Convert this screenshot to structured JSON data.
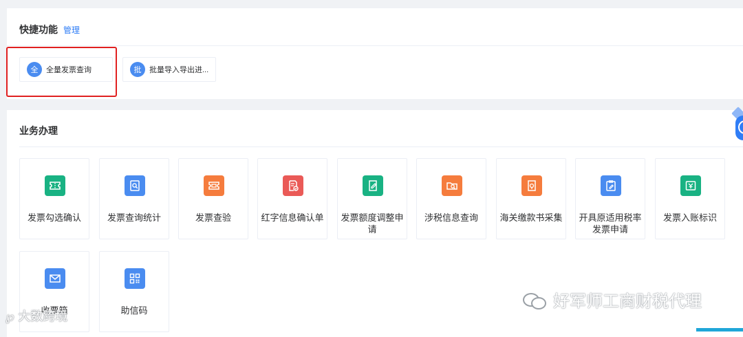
{
  "quick": {
    "title": "快捷功能",
    "manage_link": "管理",
    "items": [
      {
        "badge": "全",
        "label": "全量发票查询"
      },
      {
        "badge": "批",
        "label": "批量导入导出进..."
      }
    ]
  },
  "business": {
    "title": "业务办理",
    "cards": [
      {
        "label": "发票勾选确认",
        "icon": "ticket-icon",
        "color": "#19b283"
      },
      {
        "label": "发票查询统计",
        "icon": "search-document-icon",
        "color": "#4a8cf0"
      },
      {
        "label": "发票查验",
        "icon": "ticket-verify-icon",
        "color": "#f57c3d"
      },
      {
        "label": "红字信息确认单",
        "icon": "document-check-icon",
        "color": "#ea5a57"
      },
      {
        "label": "发票额度调整申请",
        "icon": "edit-document-icon",
        "color": "#19b283"
      },
      {
        "label": "涉税信息查询",
        "icon": "search-folder-icon",
        "color": "#f57c3d"
      },
      {
        "label": "海关缴款书采集",
        "icon": "upload-document-icon",
        "color": "#f57c3d"
      },
      {
        "label": "开具原适用税率发票申请",
        "icon": "clipboard-edit-icon",
        "color": "#4a8cf0"
      },
      {
        "label": "发票入账标识",
        "icon": "ledger-icon",
        "color": "#19b283"
      },
      {
        "label": "收票箱",
        "icon": "mail-icon",
        "color": "#4a8cf0"
      },
      {
        "label": "助信码",
        "icon": "qr-code-icon",
        "color": "#4a8cf0"
      }
    ]
  },
  "watermarks": {
    "right": "好军师工商财税代理",
    "left": "大数跨境"
  }
}
